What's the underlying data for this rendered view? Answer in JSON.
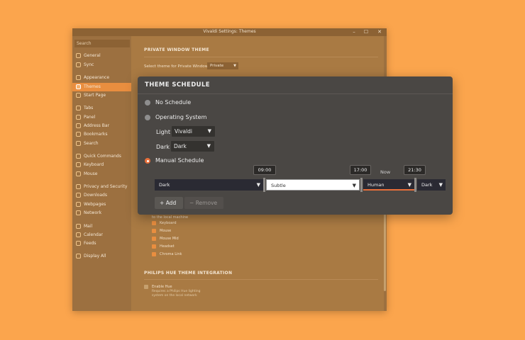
{
  "window": {
    "title": "Vivaldi Settings: Themes",
    "minimize": "–",
    "maximize": "☐",
    "close": "✕"
  },
  "sidebar": {
    "search_placeholder": "Search",
    "items": [
      {
        "label": "General",
        "icon": "general-icon"
      },
      {
        "label": "Sync",
        "icon": "sync-icon"
      },
      {
        "label": "Appearance",
        "icon": "appearance-icon"
      },
      {
        "label": "Themes",
        "icon": "themes-icon"
      },
      {
        "label": "Start Page",
        "icon": "start-page-icon"
      },
      {
        "label": "Tabs",
        "icon": "tabs-icon"
      },
      {
        "label": "Panel",
        "icon": "panel-icon"
      },
      {
        "label": "Address Bar",
        "icon": "address-bar-icon"
      },
      {
        "label": "Bookmarks",
        "icon": "bookmarks-icon"
      },
      {
        "label": "Search",
        "icon": "search-icon"
      },
      {
        "label": "Quick Commands",
        "icon": "quick-commands-icon"
      },
      {
        "label": "Keyboard",
        "icon": "keyboard-icon"
      },
      {
        "label": "Mouse",
        "icon": "mouse-icon"
      },
      {
        "label": "Privacy and Security",
        "icon": "privacy-icon"
      },
      {
        "label": "Downloads",
        "icon": "downloads-icon"
      },
      {
        "label": "Webpages",
        "icon": "webpages-icon"
      },
      {
        "label": "Network",
        "icon": "network-icon"
      },
      {
        "label": "Mail",
        "icon": "mail-icon"
      },
      {
        "label": "Calendar",
        "icon": "calendar-icon"
      },
      {
        "label": "Feeds",
        "icon": "feeds-icon"
      },
      {
        "label": "Display All",
        "icon": "display-all-icon"
      }
    ]
  },
  "content": {
    "private_heading": "PRIVATE WINDOW THEME",
    "private_label": "Select theme for Private Windows",
    "private_value": "Private",
    "inputs_note": "to the local machine",
    "inputs": [
      "Keyboard",
      "Mouse",
      "Mouse Mid",
      "Headset",
      "Chroma Link"
    ],
    "hue_heading": "PHILIPS HUE THEME INTEGRATION",
    "hue_enable": "Enable Hue",
    "hue_desc_1": "Requires a Philips Hue lighting",
    "hue_desc_2": "system on the local network"
  },
  "dialog": {
    "title": "THEME SCHEDULE",
    "no_schedule": "No Schedule",
    "operating_system": "Operating System",
    "light_label": "Light",
    "light_value": "Vivaldi",
    "dark_label": "Dark",
    "dark_value": "Dark",
    "manual_schedule": "Manual Schedule",
    "times": [
      "09:00",
      "17:00",
      "21:30"
    ],
    "now_label": "Now",
    "segments": [
      "Dark",
      "Subtle",
      "Human",
      "Dark"
    ],
    "add_label": "Add",
    "remove_label": "Remove",
    "accent_color": "#E86F3A"
  }
}
